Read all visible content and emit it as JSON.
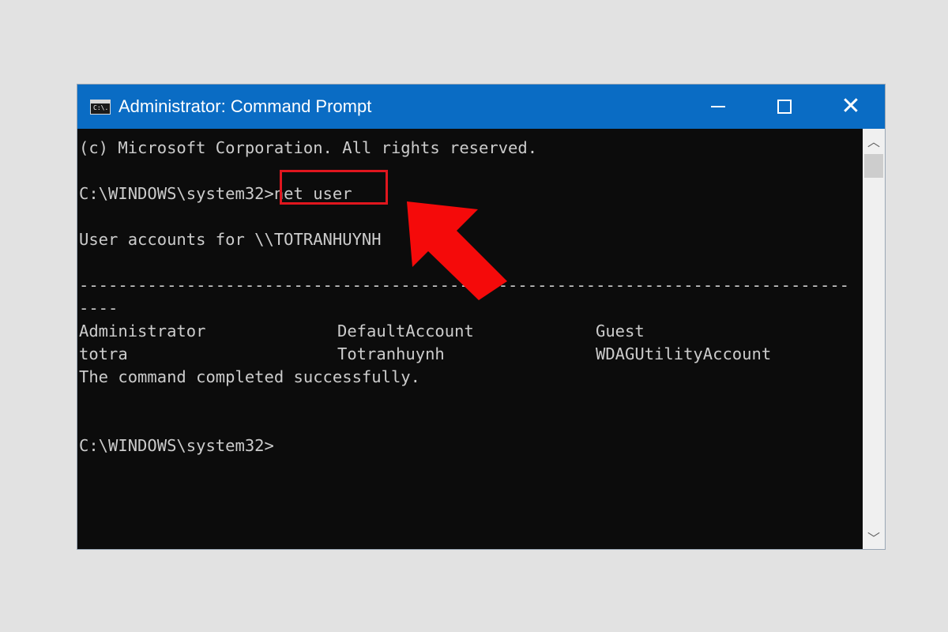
{
  "window": {
    "title": "Administrator: Command Prompt",
    "icon": "cmd-icon",
    "icon_text": "C:\\."
  },
  "console": {
    "lines": [
      "(c) Microsoft Corporation. All rights reserved.",
      "",
      "C:\\WINDOWS\\system32>net user",
      "",
      "User accounts for \\\\TOTRANHUYNH",
      "",
      "-------------------------------------------------------------------------------",
      "----"
    ],
    "accounts": [
      [
        "Administrator",
        "DefaultAccount",
        "Guest"
      ],
      [
        "totra",
        "Totranhuynh",
        "WDAGUtilityAccount"
      ]
    ],
    "status": "The command completed successfully.",
    "prompt": "C:\\WINDOWS\\system32>"
  },
  "colors": {
    "titlebar": "#0a6cc4",
    "console_bg": "#0c0c0c",
    "console_text": "#cccccc",
    "annotation": "#e0161e"
  }
}
